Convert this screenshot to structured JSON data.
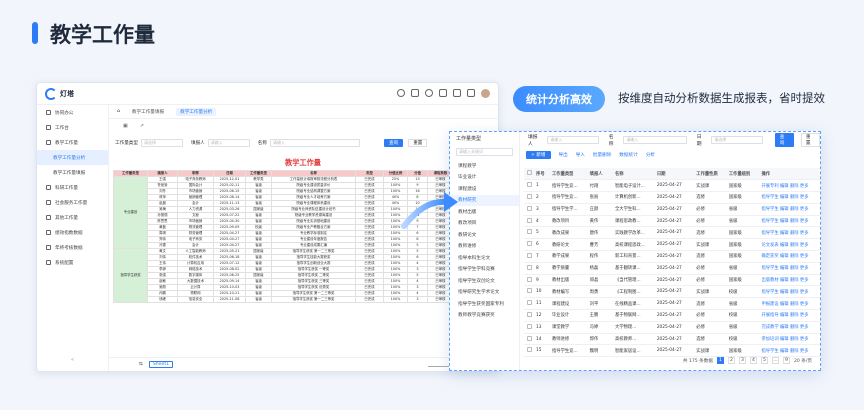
{
  "page": {
    "title": "教学工作量",
    "feature_pill": "统计分析高效",
    "feature_desc": "按维度自动分析数据生成报表，省时提效"
  },
  "window1": {
    "logo_text": "灯塔",
    "nav": [
      {
        "label": "协同办公",
        "sub": false,
        "active": false
      },
      {
        "label": "工作台",
        "sub": false,
        "active": false
      },
      {
        "label": "教学工作量",
        "sub": false,
        "active": false
      },
      {
        "label": "教学工作量分析",
        "sub": true,
        "active": true
      },
      {
        "label": "教学工作量填报",
        "sub": true,
        "active": false
      },
      {
        "label": "科研工作量",
        "sub": false,
        "active": false
      },
      {
        "label": "社会服务工作量",
        "sub": false,
        "active": false
      },
      {
        "label": "其他工作量",
        "sub": false,
        "active": false
      },
      {
        "label": "绩效指数数据",
        "sub": false,
        "active": false
      },
      {
        "label": "年终考核数据",
        "sub": false,
        "active": false
      },
      {
        "label": "系统配置",
        "sub": false,
        "active": false
      }
    ],
    "tabs": [
      "教学工作量填报",
      "教学工作量分析"
    ],
    "filter": {
      "type_label": "工作量类型",
      "type_placeholder": "请选择",
      "person_label": "填报人",
      "person_placeholder": "请输入",
      "name_label": "名称",
      "name_placeholder": "请输入",
      "query": "查询",
      "reset": "重置"
    },
    "sheet_title": "教学工作量",
    "sheet_tab": "Sheet1",
    "headers": [
      "工作量类型",
      "填报人",
      "职称",
      "日期",
      "工作量类型",
      "名称",
      "类型",
      "分值比例",
      "分值",
      "课程系数"
    ],
    "groups": [
      {
        "label": "专业建设",
        "start": 1,
        "span": 12
      },
      {
        "label": "指导学生获奖",
        "start": 13,
        "span": 9
      }
    ],
    "rows": [
      [
        "王强",
        "电子商务教师",
        "2025-12-01",
        "教学类",
        "工作量统计填报审核流程分析表",
        "已完成",
        "25%",
        "13",
        "已审核"
      ],
      [
        "鲁曼曼",
        "国际会计",
        "2025-02-11",
        "省级",
        "院级专业建设质量评价",
        "已完成",
        "100%",
        "9",
        "已审核"
      ],
      [
        "刘冬",
        "市场营销",
        "2025-06-15",
        "省级",
        "院级专业结构调整方案",
        "已完成",
        "100%",
        "16",
        "已审核"
      ],
      [
        "林萍",
        "营销管理",
        "2025-08-14",
        "省级",
        "院级专业人才培养方案",
        "已完成",
        "40%",
        "8",
        "已审核"
      ],
      [
        "赵晨",
        "会计",
        "2025-11-13",
        "省级",
        "院级专业课程体系建设",
        "已完成",
        "40%",
        "10",
        "已审核"
      ],
      [
        "吴梅",
        "人力资源",
        "2025-03-26",
        "国家级",
        "院级专业师资队伍建设计划书",
        "已完成",
        "100%",
        "14",
        "已审核"
      ],
      [
        "孙丽丽",
        "文秘",
        "2025-07-22",
        "省级",
        "院级专业教学资源库建设",
        "已完成",
        "100%",
        "11",
        "已审核"
      ],
      [
        "陈思思",
        "市场营销",
        "2025-04-30",
        "省级",
        "院级专业实训基地建设",
        "已完成",
        "100%",
        "9",
        "已审核"
      ],
      [
        "黄磊",
        "物流管理",
        "2025-09-09",
        "校级",
        "院级专业产教融合方案",
        "已完成",
        "100%",
        "7",
        "已审核"
      ],
      [
        "周琪",
        "财务管理",
        "2025-04-27",
        "省级",
        "专业教学标准制定",
        "已完成",
        "100%",
        "6",
        "已审核"
      ],
      [
        "郑伟",
        "电子商务",
        "2025-04-27",
        "省级",
        "专业建设年度报告",
        "已完成",
        "100%",
        "8",
        "已审核"
      ],
      [
        "冯雪",
        "会计",
        "2025-04-27",
        "省级",
        "专业建设成果汇编",
        "已完成",
        "100%",
        "5",
        "已审核"
      ],
      [
        "黄文",
        "人工智能教师",
        "2025-05-21",
        "国家级",
        "指导学生获奖 第一二三等奖",
        "已完成",
        "100%",
        "5",
        "已审核"
      ],
      [
        "刘伟",
        "软件技术",
        "2025-06-18",
        "省级",
        "指导学生技能大赛获奖",
        "已完成",
        "100%",
        "6",
        "已审核"
      ],
      [
        "王伟",
        "计算机应用",
        "2025-07-12",
        "省级",
        "指导学生创新创业大赛",
        "已完成",
        "100%",
        "4",
        "已审核"
      ],
      [
        "李静",
        "网络技术",
        "2025-08-02",
        "省级",
        "指导学生获奖 一等奖",
        "已完成",
        "100%",
        "3",
        "已审核"
      ],
      [
        "张强",
        "数字媒体",
        "2025-08-25",
        "国家级",
        "指导学生获奖 二等奖",
        "已完成",
        "100%",
        "5",
        "已审核"
      ],
      [
        "赵敏",
        "大数据技术",
        "2025-09-14",
        "省级",
        "指导学生获奖 三等奖",
        "已完成",
        "100%",
        "4",
        "已审核"
      ],
      [
        "吴刚",
        "云计算",
        "2025-10-03",
        "省级",
        "指导学生获奖 优秀奖",
        "已完成",
        "100%",
        "3",
        "已审核"
      ],
      [
        "孙鹏",
        "物联网",
        "2025-10-21",
        "省级",
        "指导学生获奖 第一二三等奖",
        "已完成",
        "100%",
        "4",
        "已审核"
      ],
      [
        "钱峰",
        "信息安全",
        "2025-11-08",
        "省级",
        "指导学生获奖 第一二三等奖",
        "已完成",
        "100%",
        "3",
        "已审核"
      ]
    ]
  },
  "window2": {
    "left_head": "工作量类型",
    "search_placeholder": "请输入关键词",
    "categories": [
      "课程教学",
      "毕业设计",
      "课程建设",
      "教材研究",
      "教材出版",
      "教改项目",
      "教研论文",
      "教师进修",
      "指导本科生论文",
      "指导学生学科竞赛",
      "指导学生双创论文",
      "指导研究生学术论文",
      "指导学生获奖国家专利",
      "教师教学竞赛获奖"
    ],
    "filter": {
      "person_label": "填报人",
      "person_placeholder": "请输入",
      "name_label": "名称",
      "name_placeholder": "请输入",
      "date_label": "日期",
      "date_placeholder": "请选择",
      "query": "查询",
      "reset": "重置"
    },
    "toolbar": [
      "+ 新增",
      "导出",
      "导入",
      "批量删除",
      "数据统计",
      "分析"
    ],
    "headers": [
      "序号",
      "工作量类型",
      "填报人",
      "名称",
      "日期",
      "工作量性质",
      "工作量级别",
      "操作"
    ],
    "rows": [
      [
        "1",
        "指导学生竞...",
        "付翔",
        "智能电子设计...",
        "2025-04-27",
        "实战课",
        "国家级",
        "开展专利 编辑 删除 更多"
      ],
      [
        "2",
        "指导学生竞...",
        "张丽",
        "计算机创新...",
        "2025-04-27",
        "选修",
        "国家级",
        "指导学生 编辑 删除 更多"
      ],
      [
        "3",
        "指导学生学...",
        "庄颜",
        "全大学生科...",
        "2025-04-27",
        "必修",
        "省级",
        "指导学生 编辑 删除 更多"
      ],
      [
        "4",
        "教改项目",
        "黄伟",
        "课程思政教...",
        "2025-04-27",
        "必修",
        "省级",
        "指导学生 编辑 删除 更多"
      ],
      [
        "5",
        "教改成果",
        "唐伟",
        "实践教学改革...",
        "2025-04-27",
        "选修",
        "国家级",
        "指导学生 编辑 删除 更多"
      ],
      [
        "6",
        "教研论文",
        "曹芳",
        "高校课程思政...",
        "2025-04-27",
        "实战课",
        "国家级",
        "论文发表 编辑 删除 更多"
      ],
      [
        "7",
        "教学成果",
        "程伟",
        "新工科背景...",
        "2025-04-27",
        "选修",
        "国家级",
        "确定获奖 编辑 删除 更多"
      ],
      [
        "8",
        "教学质量",
        "杨磊",
        "基于翻转课...",
        "2025-04-27",
        "必修",
        "省级",
        "指导学生 编辑 删除 更多"
      ],
      [
        "9",
        "教材出版",
        "郑晶",
        "《当代管理...",
        "2025-04-27",
        "必修",
        "国家级",
        "出版教材 编辑 删除 更多"
      ],
      [
        "10",
        "教材编写",
        "周勇",
        "《工程制图...",
        "2025-04-27",
        "实战课",
        "校级",
        "指导学生 编辑 删除 更多"
      ],
      [
        "11",
        "课程建设",
        "刘平",
        "在线精品课...",
        "2025-04-27",
        "选修",
        "省级",
        "申报建设 编辑 删除 更多"
      ],
      [
        "12",
        "毕业设计",
        "王鹏",
        "基于物联网...",
        "2025-04-27",
        "必修",
        "校级",
        "开展指导 编辑 删除 更多"
      ],
      [
        "13",
        "课堂教学",
        "冯婷",
        "大学物理...",
        "2025-04-27",
        "必修",
        "省级",
        "完成教学 编辑 删除 更多"
      ],
      [
        "14",
        "教师进修",
        "郭伟",
        "高校教师...",
        "2025-04-27",
        "选修",
        "校级",
        "参加培训 编辑 删除 更多"
      ],
      [
        "15",
        "指导学生竞...",
        "魏明",
        "智能家居设...",
        "2025-04-27",
        "实战课",
        "国家级",
        "指导学生 编辑 删除 更多"
      ]
    ],
    "pagination": {
      "total": "共 175 条数据",
      "pages": [
        "1",
        "2",
        "3",
        "4",
        "5",
        "...",
        "9"
      ],
      "size": "20 条/页"
    }
  }
}
